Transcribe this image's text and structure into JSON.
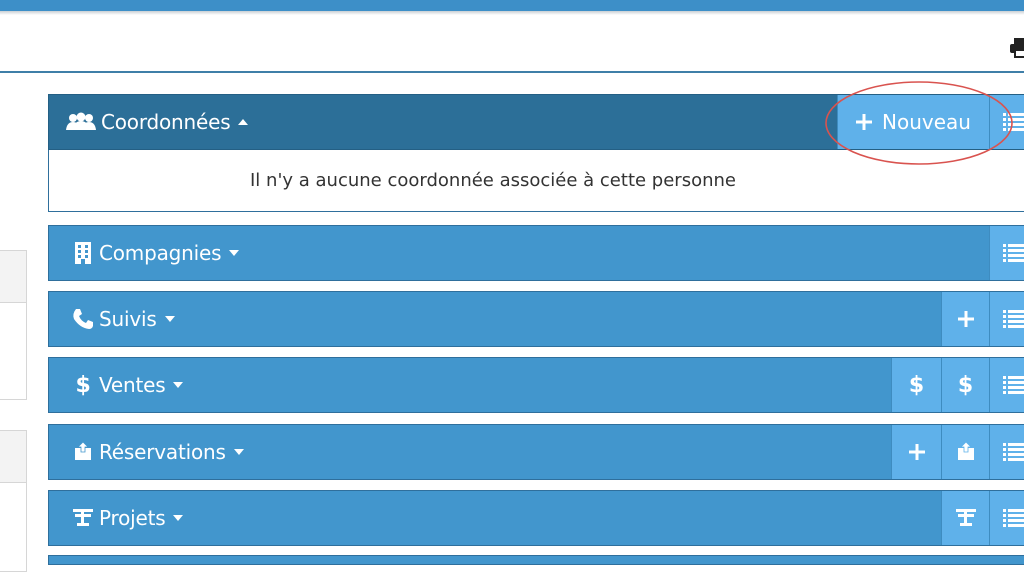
{
  "panels": [
    {
      "title": "Coordonnées",
      "icon": "contacts-icon",
      "expanded": true,
      "empty_message": "Il n'y a aucune coordonnée associée à cette personne",
      "new_label": "Nouveau"
    },
    {
      "title": "Compagnies",
      "icon": "building-icon",
      "expanded": false
    },
    {
      "title": "Suivis",
      "icon": "phone-icon",
      "expanded": false
    },
    {
      "title": "Ventes",
      "icon": "dollar-icon",
      "expanded": false
    },
    {
      "title": "Réservations",
      "icon": "reservation-icon",
      "expanded": false
    },
    {
      "title": "Projets",
      "icon": "projects-icon",
      "expanded": false
    }
  ],
  "colors": {
    "panel_blue": "#4296cd",
    "panel_dark": "#2c6f98",
    "button_blue": "#5fb1ea",
    "highlight_red": "#d9534f"
  }
}
